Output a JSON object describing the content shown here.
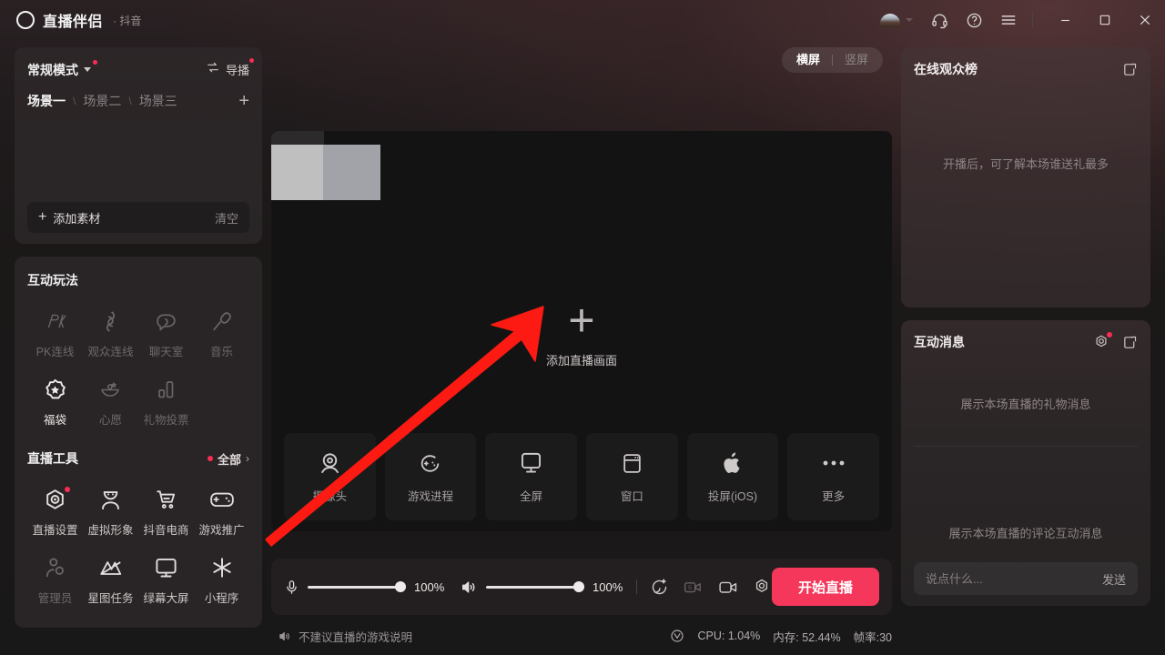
{
  "titlebar": {
    "app_name": "直播伴侣",
    "app_sub": "· 抖音",
    "icons": [
      {
        "name": "headset-support-icon",
        "label": "客服"
      },
      {
        "name": "help-question-icon",
        "label": "帮助"
      },
      {
        "name": "menu-hamburger-icon",
        "label": "菜单"
      }
    ],
    "window_controls": [
      "minimize",
      "maximize",
      "close"
    ]
  },
  "scenes": {
    "mode_label": "常规模式",
    "director_label": "导播",
    "tabs": [
      {
        "label": "场景一",
        "active": true
      },
      {
        "label": "场景二",
        "active": false
      },
      {
        "label": "场景三",
        "active": false
      }
    ],
    "separator": "\\",
    "add_tab": "+",
    "add_material_label": "添加素材",
    "clear_label": "清空"
  },
  "interactive": {
    "title": "互动玩法",
    "items": [
      {
        "label": "PK连线",
        "icon": "pk-icon",
        "dim": true,
        "badge": false
      },
      {
        "label": "观众连线",
        "icon": "audience-link-icon",
        "dim": true,
        "badge": false
      },
      {
        "label": "聊天室",
        "icon": "chatroom-icon",
        "dim": true,
        "badge": false
      },
      {
        "label": "音乐",
        "icon": "microphone-music-icon",
        "dim": true,
        "badge": false
      },
      {
        "label": "福袋",
        "icon": "lucky-bag-icon",
        "dim": false,
        "badge": false
      },
      {
        "label": "心愿",
        "icon": "wish-icon",
        "dim": true,
        "badge": false
      },
      {
        "label": "礼物投票",
        "icon": "gift-vote-icon",
        "dim": true,
        "badge": false
      }
    ]
  },
  "live_tools": {
    "title": "直播工具",
    "more_label": "全部",
    "more_chevron": "›",
    "items": [
      {
        "label": "直播设置",
        "icon": "live-settings-icon",
        "dim": false,
        "badge": true
      },
      {
        "label": "虚拟形象",
        "icon": "avatar-virtual-icon",
        "dim": false,
        "badge": false
      },
      {
        "label": "抖音电商",
        "icon": "shopping-cart-icon",
        "dim": false,
        "badge": false
      },
      {
        "label": "游戏推广",
        "icon": "gamepad-icon",
        "dim": false,
        "badge": false
      },
      {
        "label": "管理员",
        "icon": "admin-user-icon",
        "dim": true,
        "badge": false
      },
      {
        "label": "星图任务",
        "icon": "star-map-task-icon",
        "dim": false,
        "badge": false
      },
      {
        "label": "绿幕大屏",
        "icon": "greenscreen-monitor-icon",
        "dim": false,
        "badge": false
      },
      {
        "label": "小程序",
        "icon": "miniprogram-icon",
        "dim": false,
        "badge": false
      }
    ]
  },
  "preview": {
    "orientation": [
      {
        "label": "横屏",
        "active": true
      },
      {
        "label": "竖屏",
        "active": false
      }
    ],
    "add_screen_plus": "+",
    "add_screen_label": "添加直播画面",
    "sources": [
      {
        "label": "摄像头",
        "icon": "webcam-icon"
      },
      {
        "label": "游戏进程",
        "icon": "game-process-icon"
      },
      {
        "label": "全屏",
        "icon": "fullscreen-monitor-icon"
      },
      {
        "label": "窗口",
        "icon": "window-capture-icon"
      },
      {
        "label": "投屏(iOS)",
        "icon": "apple-airplay-icon"
      },
      {
        "label": "更多",
        "icon": "more-dots-icon"
      }
    ]
  },
  "controls": {
    "mic": {
      "icon": "microphone-icon",
      "value": "100%",
      "percent": 100
    },
    "speaker": {
      "icon": "speaker-icon",
      "value": "100%",
      "percent": 100
    },
    "icons": [
      {
        "name": "beauty-face-icon",
        "dim": false
      },
      {
        "name": "delay-5s-icon",
        "dim": true
      },
      {
        "name": "camera-video-icon",
        "dim": false
      },
      {
        "name": "settings-gear-icon",
        "dim": false
      }
    ],
    "go_live_label": "开始直播",
    "go_live_color": "#f4375a"
  },
  "statusbar": {
    "warning_icon": "speaker-mute-icon",
    "warning_text": "不建议直播的游戏说明",
    "net_icon": "network-quality-icon",
    "cpu": "CPU: 1.04%",
    "memory": "内存: 52.44%",
    "fps": "帧率:30"
  },
  "rank_panel": {
    "title": "在线观众榜",
    "popout_icon": "popout-window-icon",
    "empty_text": "开播后，可了解本场谁送礼最多"
  },
  "message_panel": {
    "title": "互动消息",
    "settings_icon": "message-settings-icon",
    "popout_icon": "popout-window-icon",
    "gift_placeholder": "展示本场直播的礼物消息",
    "comment_placeholder": "展示本场直播的评论互动消息",
    "input_placeholder": "说点什么...",
    "send_label": "发送"
  },
  "annotation": {
    "type": "red-arrow",
    "color": "#fc1a12",
    "from": [
      292,
      592
    ],
    "to": [
      597,
      337
    ]
  }
}
